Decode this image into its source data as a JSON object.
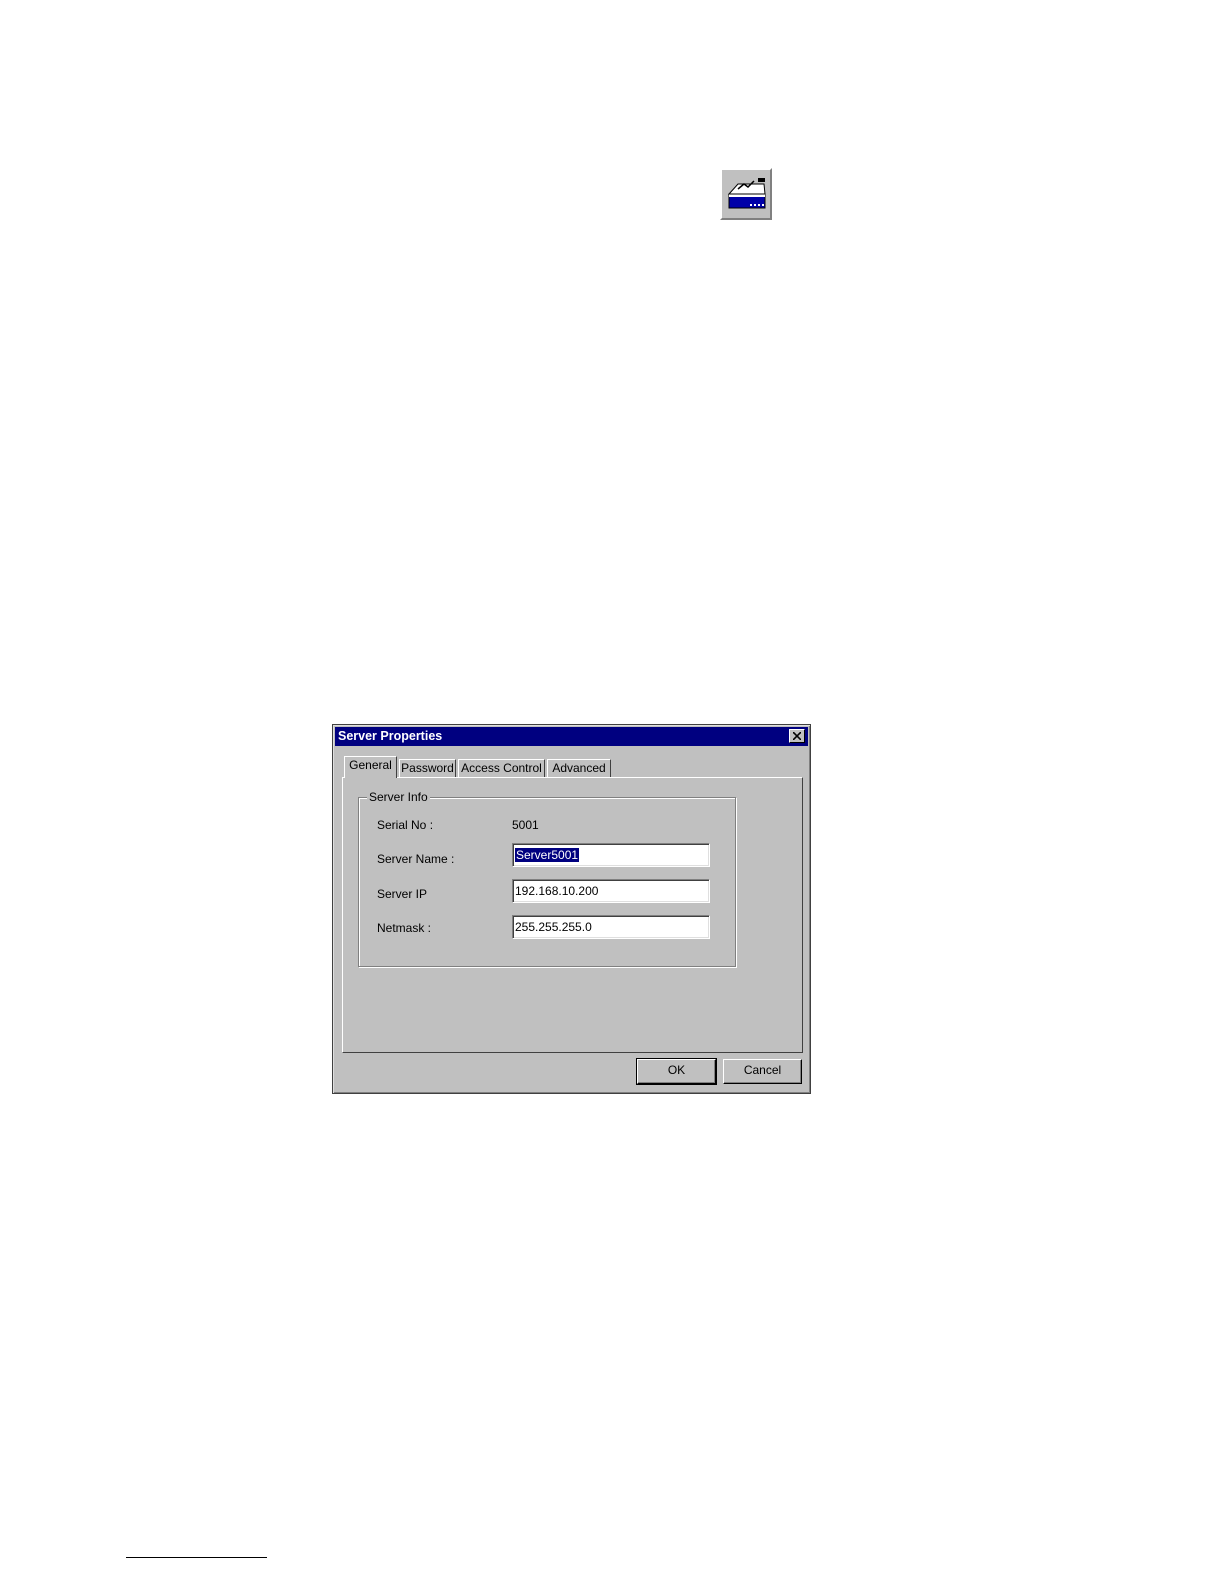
{
  "toolbar_icon": {
    "name": "server-properties-icon"
  },
  "dialog": {
    "title": "Server Properties",
    "tabs": [
      {
        "label": "General",
        "active": true
      },
      {
        "label": "Password",
        "active": false
      },
      {
        "label": "Access Control",
        "active": false
      },
      {
        "label": "Advanced",
        "active": false
      }
    ],
    "group_label": "Server Info",
    "serial_label": "Serial No :",
    "serial_value": "5001",
    "server_name_label": "Server Name :",
    "server_name_value": "Server5001",
    "server_ip_label": "Server IP",
    "server_ip_value": "192.168.10.200",
    "netmask_label": "Netmask :",
    "netmask_value": "255.255.255.0",
    "ok_label": "OK",
    "cancel_label": "Cancel"
  },
  "colors": {
    "titlebar": "#000080",
    "dialog_face": "#c0c0c0",
    "selection": "#000080"
  }
}
